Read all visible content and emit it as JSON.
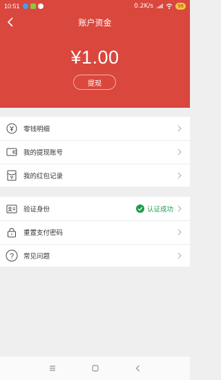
{
  "status_bar": {
    "time": "10:51",
    "network_speed": "0.2K/s",
    "battery": "98"
  },
  "nav": {
    "title": "账户资金"
  },
  "account": {
    "balance": "¥1.00",
    "withdraw_label": "提现"
  },
  "menu_group_1": [
    {
      "label": "零钱明细",
      "icon": "coin-icon"
    },
    {
      "label": "我的提现账号",
      "icon": "wallet-icon"
    },
    {
      "label": "我的红包记录",
      "icon": "red-envelope-icon"
    }
  ],
  "menu_group_2": [
    {
      "label": "验证身份",
      "icon": "id-card-icon",
      "status": "认证成功"
    },
    {
      "label": "重置支付密码",
      "icon": "lock-icon"
    },
    {
      "label": "常见问题",
      "icon": "question-icon"
    }
  ],
  "colors": {
    "header": "#d9473d",
    "verified": "#1f9b4a"
  }
}
